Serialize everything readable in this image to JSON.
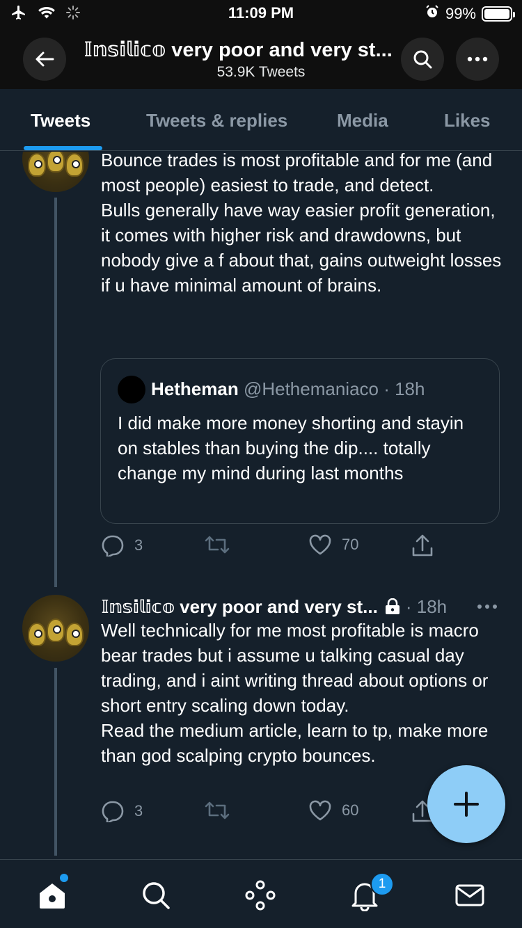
{
  "status_bar": {
    "time": "11:09 PM",
    "battery": "99%",
    "battery_level": 0.99
  },
  "header": {
    "title": "𝕀𝕟𝕤𝕚𝕝𝕚𝕔𝕠 very poor and very st...",
    "subtitle": "53.9K Tweets"
  },
  "tabs": [
    {
      "label": "Tweets",
      "active": true
    },
    {
      "label": "Tweets & replies",
      "active": false
    },
    {
      "label": "Media",
      "active": false
    },
    {
      "label": "Likes",
      "active": false
    }
  ],
  "tweet1": {
    "text_lines": [
      "Bounce trades is most profitable and for me (and most people) easiest to trade, and detect.",
      "Bulls generally have way easier profit generation, it comes with higher risk and drawdowns, but nobody give a f about that, gains outweight losses if u have minimal amount of brains."
    ],
    "quote": {
      "name": "Hetheman",
      "handle": "@Hethemaniaco · 18h",
      "text": "I did make more money shorting and stayin on stables than buying the dip.... totally change my mind during last months"
    },
    "replies": "3",
    "retweets": "",
    "likes": "70"
  },
  "tweet2": {
    "name": "𝕀𝕟𝕤𝕚𝕝𝕚𝕔𝕠 very poor and very st...",
    "time": "· 18h",
    "text_lines": [
      "Well technically for me most profitable is macro bear trades but i assume u talking casual day trading, and i aint writing thread about options or short entry scaling down today.",
      "Read the medium article, learn to tp, make more than god scalping crypto bounces."
    ],
    "replies": "3",
    "retweets": "",
    "likes": "60"
  },
  "nav": {
    "notifications_badge": "1"
  },
  "colors": {
    "accent": "#1d9bf0",
    "background": "#15202b",
    "fab": "#8ecdf7",
    "muted": "#8b98a5"
  }
}
